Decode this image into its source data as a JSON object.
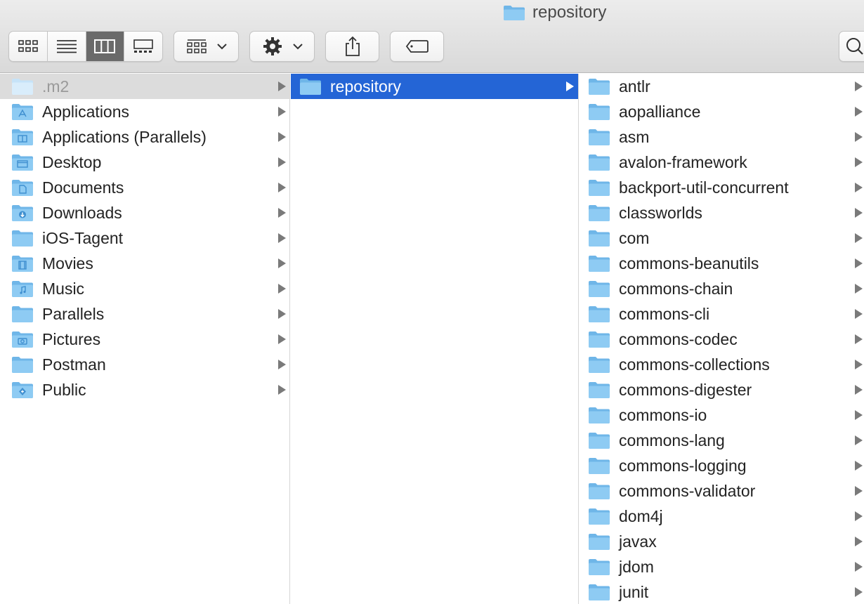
{
  "window": {
    "title": "repository"
  },
  "toolbar": {
    "view_buttons": [
      "icon-view",
      "list-view",
      "column-view",
      "gallery-view"
    ],
    "active_view": "column-view"
  },
  "columns": [
    {
      "items": [
        {
          "label": ".m2",
          "icon": "hidden-folder-icon",
          "state": "dimmed"
        },
        {
          "label": "Applications",
          "icon": "applications-folder-icon"
        },
        {
          "label": "Applications (Parallels)",
          "icon": "parallels-apps-folder-icon"
        },
        {
          "label": "Desktop",
          "icon": "desktop-folder-icon"
        },
        {
          "label": "Documents",
          "icon": "documents-folder-icon"
        },
        {
          "label": "Downloads",
          "icon": "downloads-folder-icon"
        },
        {
          "label": "iOS-Tagent",
          "icon": "folder-icon"
        },
        {
          "label": "Movies",
          "icon": "movies-folder-icon"
        },
        {
          "label": "Music",
          "icon": "music-folder-icon"
        },
        {
          "label": "Parallels",
          "icon": "folder-icon"
        },
        {
          "label": "Pictures",
          "icon": "pictures-folder-icon"
        },
        {
          "label": "Postman",
          "icon": "folder-icon"
        },
        {
          "label": "Public",
          "icon": "public-folder-icon"
        }
      ]
    },
    {
      "items": [
        {
          "label": "repository",
          "icon": "folder-icon",
          "state": "selected"
        }
      ]
    },
    {
      "items": [
        {
          "label": "antlr"
        },
        {
          "label": "aopalliance"
        },
        {
          "label": "asm"
        },
        {
          "label": "avalon-framework"
        },
        {
          "label": "backport-util-concurrent"
        },
        {
          "label": "classworlds"
        },
        {
          "label": "com"
        },
        {
          "label": "commons-beanutils"
        },
        {
          "label": "commons-chain"
        },
        {
          "label": "commons-cli"
        },
        {
          "label": "commons-codec"
        },
        {
          "label": "commons-collections"
        },
        {
          "label": "commons-digester"
        },
        {
          "label": "commons-io"
        },
        {
          "label": "commons-lang"
        },
        {
          "label": "commons-logging"
        },
        {
          "label": "commons-validator"
        },
        {
          "label": "dom4j"
        },
        {
          "label": "javax"
        },
        {
          "label": "jdom"
        },
        {
          "label": "junit"
        }
      ]
    }
  ],
  "colors": {
    "selection": "#2465d6",
    "folder": "#8ecbf3",
    "folder_tab": "#6fb6e8"
  }
}
